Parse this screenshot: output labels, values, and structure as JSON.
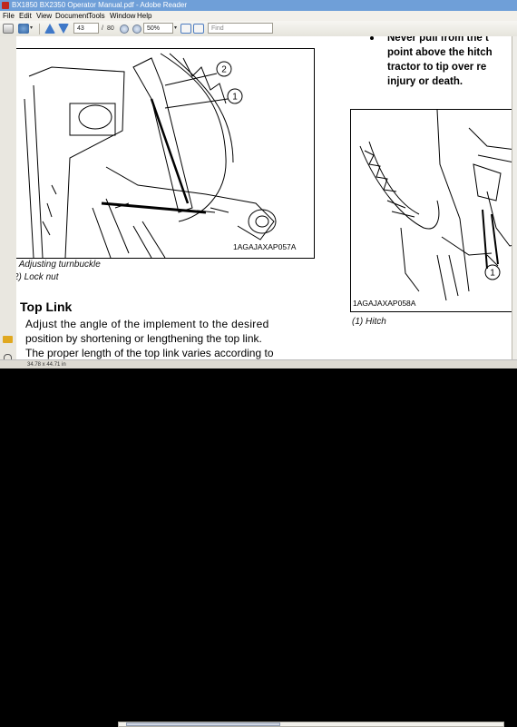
{
  "window": {
    "title": "BX1850 BX2350 Operator Manual.pdf - Adobe Reader"
  },
  "menu": [
    "File",
    "Edit",
    "View",
    "Document",
    "Tools",
    "Window",
    "Help"
  ],
  "toolbar": {
    "page_current": "43",
    "page_separator": "/",
    "page_total": "80",
    "zoom": "50%",
    "find_placeholder": "Find"
  },
  "status": {
    "page_size": "34.78 x 44.71 in"
  },
  "document": {
    "left_figure": {
      "code": "1AGAJAXAP057A",
      "callouts": [
        "2",
        "1"
      ],
      "captions": [
        ") Adjusting turnbuckle",
        "2) Lock nut"
      ]
    },
    "section_title": "Top Link",
    "body": [
      "Adjust the angle of the implement to the desired",
      "position by shortening or lengthening the top link.",
      "The proper length of the top link varies according to"
    ],
    "warning_lines": [
      "Never pull from the t",
      "point above the hitch",
      "tractor to tip over re",
      "injury or death."
    ],
    "right_figure": {
      "code": "1AGAJAXAP058A",
      "callouts": [
        "1"
      ],
      "caption": "(1) Hitch"
    }
  },
  "colors": {
    "titlebar": "#6f9fd8",
    "chrome": "#f2f0ea",
    "app_icon": "#c0281f"
  }
}
